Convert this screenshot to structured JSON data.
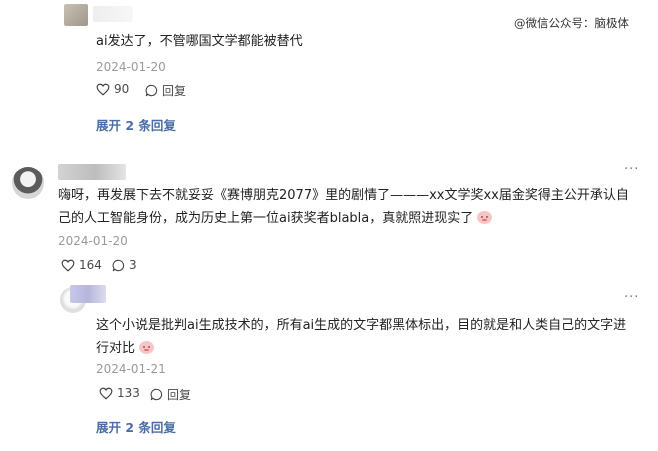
{
  "watermark": "@微信公众号：脑极体",
  "comments": [
    {
      "text": "ai发达了，不管哪国文学都能被替代",
      "date": "2024-01-20",
      "likes": "90",
      "reply_label": "回复",
      "expand": "展开 2 条回复"
    },
    {
      "more": "···",
      "text_line1": "嗨呀，再发展下去不就妥妥《赛博朋克2077》里的剧情了———xx文学奖xx届金奖得主公开承认自",
      "text_line2": "己的人工智能身份，成为历史上第一位ai获奖者blabla，真就照进现实了",
      "date": "2024-01-20",
      "likes": "164",
      "replies": "3"
    },
    {
      "more": "···",
      "text_line1": "这个小说是批判ai生成技术的，所有ai生成的文字都黑体标出，目的就是和人类自己的文字进",
      "text_line2": "行对比",
      "date": "2024-01-21",
      "likes": "133",
      "reply_label": "回复",
      "expand": "展开 2 条回复"
    }
  ],
  "icons": {
    "like": "heart-outline-icon",
    "reply": "speech-bubble-icon",
    "more": "more-dots-icon",
    "emoji": "blush-face-emoji"
  },
  "colors": {
    "link": "#4a6da7",
    "meta": "#9a9a9a"
  }
}
